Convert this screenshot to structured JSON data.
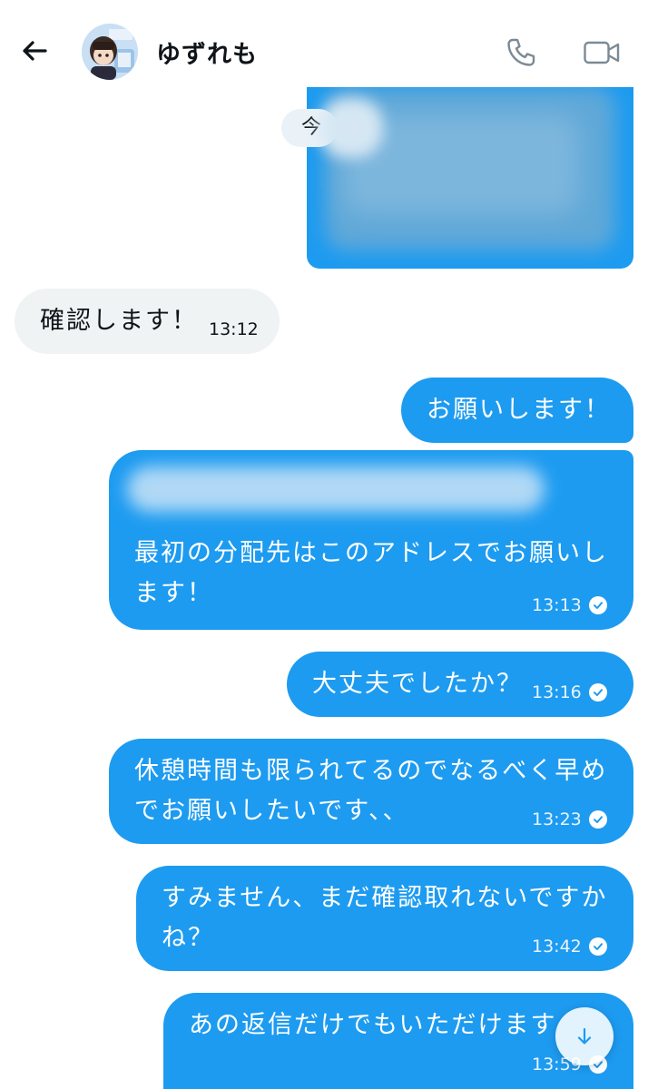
{
  "header": {
    "back_icon": "arrow-left-icon",
    "contact_name": "ゆずれも",
    "call_icon": "phone-icon",
    "video_icon": "video-camera-icon"
  },
  "date_chip": {
    "label": "今"
  },
  "messages": [
    {
      "direction": "incoming",
      "text": "確認します！",
      "time": "13:12"
    },
    {
      "direction": "outgoing",
      "text": "お願いします！"
    },
    {
      "direction": "outgoing",
      "lines": [
        "最初の分配先はこのアドレスでお願いし",
        "ます！"
      ],
      "time": "13:13",
      "read": true
    },
    {
      "direction": "outgoing",
      "text": "大丈夫でしたか？",
      "time": "13:16",
      "read": true
    },
    {
      "direction": "outgoing",
      "lines": [
        "休憩時間も限られてるのでなるべく早め",
        "でお願いしたいです、、"
      ],
      "time": "13:23",
      "read": true
    },
    {
      "direction": "outgoing",
      "lines": [
        "すみません、まだ確認取れないですか",
        "ね？"
      ],
      "time": "13:42",
      "read": true
    },
    {
      "direction": "outgoing",
      "text": "あの返信だけでもいただけます",
      "time": "13:59",
      "read": true
    }
  ],
  "fab": {
    "icon": "arrow-down-icon"
  },
  "colors": {
    "outgoing_bubble": "#1d9bf0",
    "incoming_bubble": "#eff3f4",
    "text_dark": "#0f1419",
    "text_light": "#ffffff"
  }
}
